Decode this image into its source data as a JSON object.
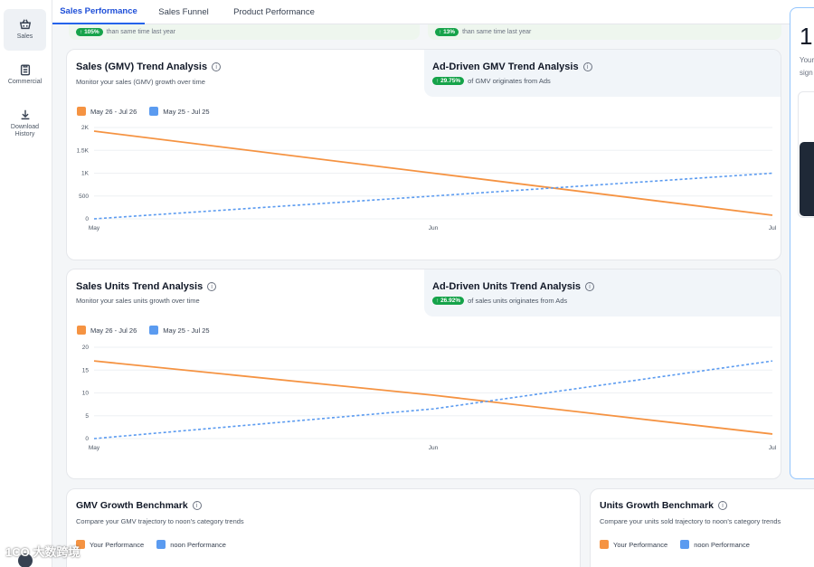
{
  "sidebar": {
    "items": [
      {
        "label": "Sales",
        "icon": "basket-icon",
        "active": true
      },
      {
        "label": "Commercial",
        "icon": "clipboard-icon",
        "active": false
      },
      {
        "label": "Download History",
        "icon": "download-icon",
        "active": false
      }
    ]
  },
  "tabs": [
    {
      "label": "Sales Performance",
      "active": true
    },
    {
      "label": "Sales Funnel",
      "active": false
    },
    {
      "label": "Product Performance",
      "active": false
    }
  ],
  "top_cards": [
    {
      "badge": "105%",
      "text": "than same time last year"
    },
    {
      "badge": "13%",
      "text": "than same time last year"
    }
  ],
  "right_panel": {
    "big": "1",
    "line1": "Your",
    "line2": "sign"
  },
  "colors": {
    "current": "#f59342",
    "previous": "#5b9bf0",
    "badge": "#16a34a",
    "accent": "#2563eb"
  },
  "gmv_panel": {
    "title": "Sales (GMV) Trend Analysis",
    "subtitle": "Monitor your sales (GMV) growth over time",
    "ad_title": "Ad-Driven GMV Trend Analysis",
    "ad_badge": "29.75%",
    "ad_text": "of GMV originates from Ads",
    "legend": [
      "May 26 - Jul 26",
      "May 25 - Jul 25"
    ]
  },
  "units_panel": {
    "title": "Sales Units Trend Analysis",
    "subtitle": "Monitor your sales units growth over time",
    "ad_title": "Ad-Driven Units Trend Analysis",
    "ad_badge": "26.92%",
    "ad_text": "of sales units originates from Ads",
    "legend": [
      "May 26 - Jul 26",
      "May 25 - Jul 25"
    ]
  },
  "chart_data": [
    {
      "type": "line",
      "x": [
        "May",
        "Jun",
        "Jul"
      ],
      "xticks": [
        "May",
        "Jun",
        "Jul"
      ],
      "yticks": [
        "0",
        "500",
        "1K",
        "1.5K",
        "2K"
      ],
      "ylim": [
        0,
        2000
      ],
      "grid": true,
      "legend_position": "top-left",
      "series": [
        {
          "name": "May 26 - Jul 26",
          "values": [
            1920,
            1000,
            80
          ],
          "style": "solid",
          "color": "#f59342"
        },
        {
          "name": "May 25 - Jul 25",
          "values": [
            0,
            500,
            1000
          ],
          "style": "dashed",
          "color": "#5b9bf0"
        }
      ]
    },
    {
      "type": "line",
      "x": [
        "May",
        "Jun",
        "Jul"
      ],
      "xticks": [
        "May",
        "Jun",
        "Jul"
      ],
      "yticks": [
        "0",
        "5",
        "10",
        "15",
        "20"
      ],
      "ylim": [
        0,
        20
      ],
      "grid": true,
      "legend_position": "top-left",
      "series": [
        {
          "name": "May 26 - Jul 26",
          "values": [
            17,
            9.5,
            1
          ],
          "style": "solid",
          "color": "#f59342"
        },
        {
          "name": "May 25 - Jul 25",
          "values": [
            0,
            6.5,
            17
          ],
          "style": "dashed",
          "color": "#5b9bf0"
        }
      ]
    }
  ],
  "benchmarks": [
    {
      "title": "GMV Growth Benchmark",
      "subtitle": "Compare your GMV trajectory to noon's category trends",
      "legend": [
        "Your Performance",
        "noon Performance"
      ]
    },
    {
      "title": "Units Growth Benchmark",
      "subtitle": "Compare your units sold trajectory to noon's category trends",
      "legend": [
        "Your Performance",
        "noon Performance"
      ]
    }
  ],
  "watermark": "1CO 大数跨境"
}
